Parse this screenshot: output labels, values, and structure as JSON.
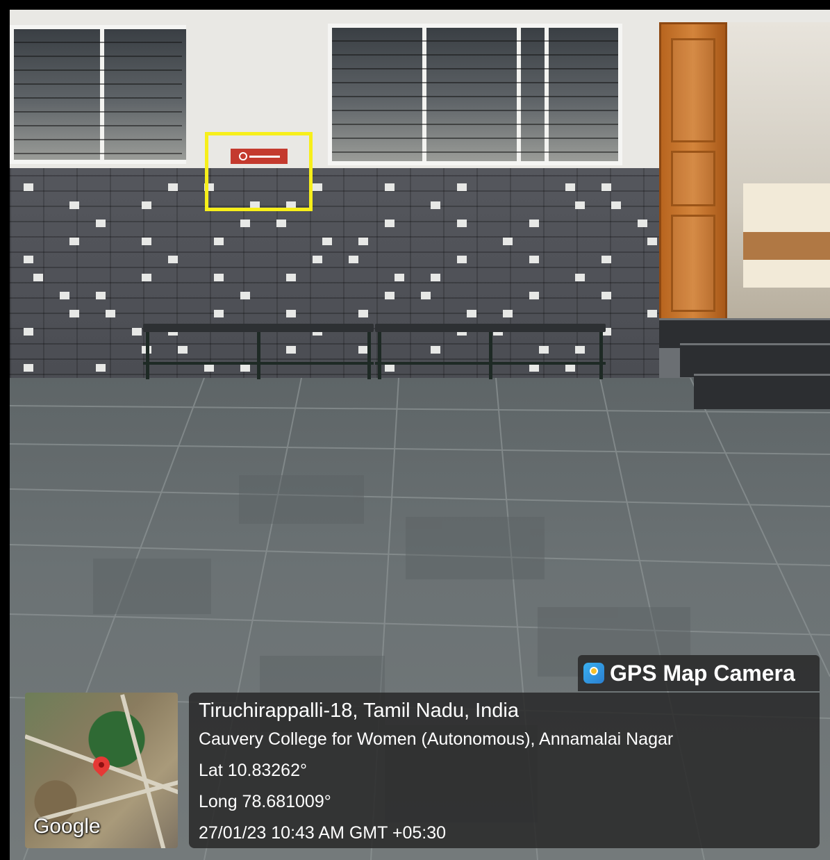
{
  "overlay": {
    "app_name": "GPS Map Camera",
    "map_logo": "Google",
    "location": "Tiruchirappalli-18, Tamil Nadu, India",
    "address": "Cauvery College for Women (Autonomous), Annamalai Nagar",
    "latitude": "Lat 10.83262°",
    "longitude": "Long 78.681009°",
    "timestamp": "27/01/23 10:43 AM GMT +05:30"
  },
  "colors": {
    "highlight": "#f7ef1a",
    "overlay_bg": "#282828",
    "pin": "#e53935"
  },
  "icons": {
    "app_icon": "gps-map-camera-icon",
    "map_pin": "map-pin-icon"
  }
}
